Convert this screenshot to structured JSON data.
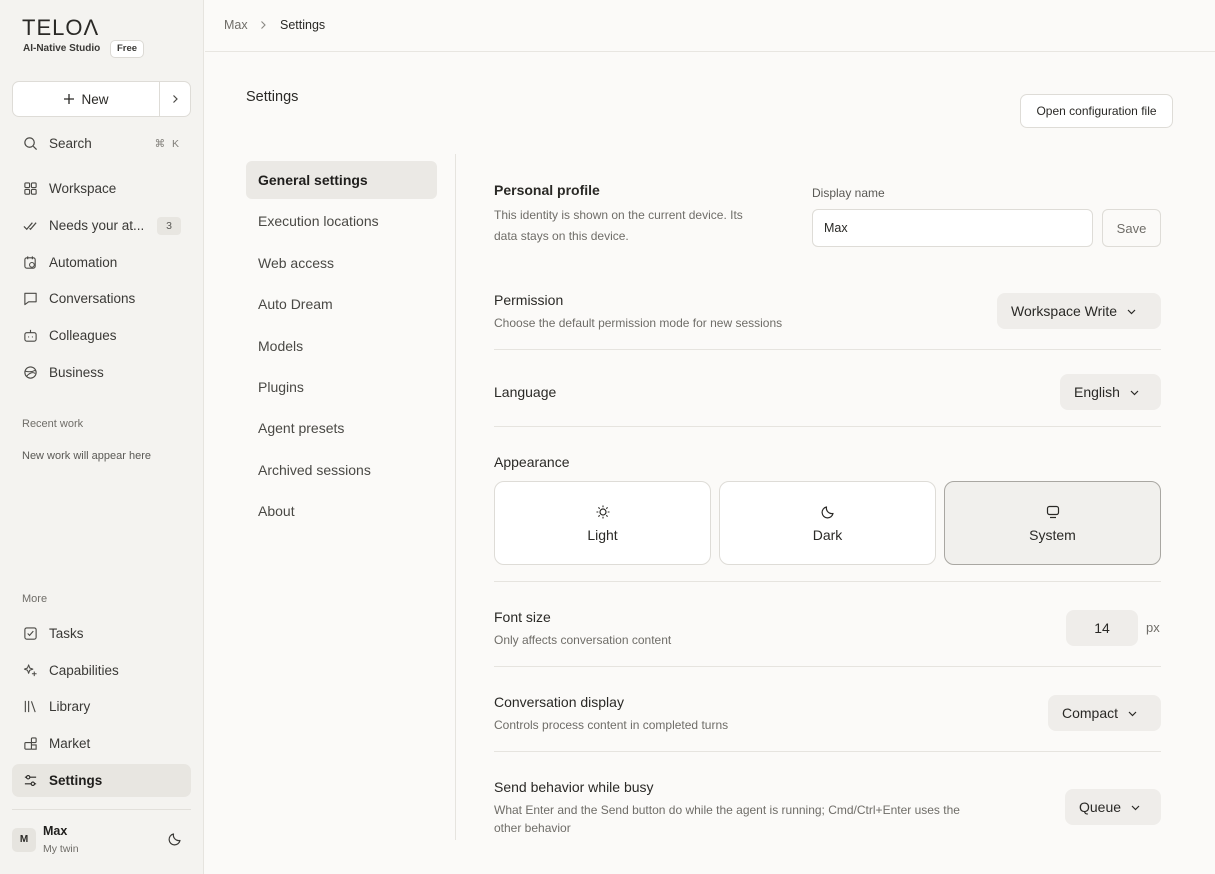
{
  "brand": {
    "logo": "TELOΛ",
    "tagline": "AI-Native Studio",
    "plan": "Free"
  },
  "sidebar": {
    "new_label": "New",
    "search": {
      "label": "Search",
      "shortcut": "⌘ K"
    },
    "items": [
      {
        "label": "Workspace",
        "icon": "grid-icon"
      },
      {
        "label": "Needs your at...",
        "icon": "check-double-icon",
        "count": "3"
      },
      {
        "label": "Automation",
        "icon": "calendar-clock-icon"
      },
      {
        "label": "Conversations",
        "icon": "chat-bubble-icon"
      },
      {
        "label": "Colleagues",
        "icon": "bot-icon"
      },
      {
        "label": "Business",
        "icon": "globe-icon"
      }
    ],
    "recent_title": "Recent work",
    "recent_empty": "New work will appear here",
    "more_title": "More",
    "more_items": [
      {
        "label": "Tasks",
        "icon": "checkbox-icon"
      },
      {
        "label": "Capabilities",
        "icon": "sparkle-icon"
      },
      {
        "label": "Library",
        "icon": "library-icon"
      },
      {
        "label": "Market",
        "icon": "blocks-icon"
      },
      {
        "label": "Settings",
        "icon": "sliders-icon",
        "active": true
      }
    ],
    "user": {
      "initial": "M",
      "name": "Max",
      "subtitle": "My twin"
    }
  },
  "breadcrumb": {
    "parent": "Max",
    "current": "Settings"
  },
  "page": {
    "title": "Settings",
    "config_button": "Open configuration file"
  },
  "settings_nav": [
    "General settings",
    "Execution locations",
    "Web access",
    "Auto Dream",
    "Models",
    "Plugins",
    "Agent presets",
    "Archived sessions",
    "About"
  ],
  "profile": {
    "title": "Personal profile",
    "desc_line1": "This identity is shown on the current device. Its",
    "desc_line2": "data stays on this device.",
    "field_label": "Display name",
    "value": "Max",
    "save": "Save"
  },
  "permission": {
    "title": "Permission",
    "desc": "Choose the default permission mode for new sessions",
    "value": "Workspace Write"
  },
  "language": {
    "title": "Language",
    "value": "English"
  },
  "appearance": {
    "title": "Appearance",
    "options": [
      {
        "label": "Light",
        "icon": "sun-icon"
      },
      {
        "label": "Dark",
        "icon": "moon-icon"
      },
      {
        "label": "System",
        "icon": "monitor-icon"
      }
    ],
    "selected": "System"
  },
  "font_size": {
    "title": "Font size",
    "desc": "Only affects conversation content",
    "value": "14",
    "unit": "px"
  },
  "conversation_display": {
    "title": "Conversation display",
    "desc": "Controls process content in completed turns",
    "value": "Compact"
  },
  "send_behavior": {
    "title": "Send behavior while busy",
    "desc_line1": "What Enter and the Send button do while the agent is running; Cmd/Ctrl+Enter uses the",
    "desc_line2": "other behavior",
    "value": "Queue"
  }
}
